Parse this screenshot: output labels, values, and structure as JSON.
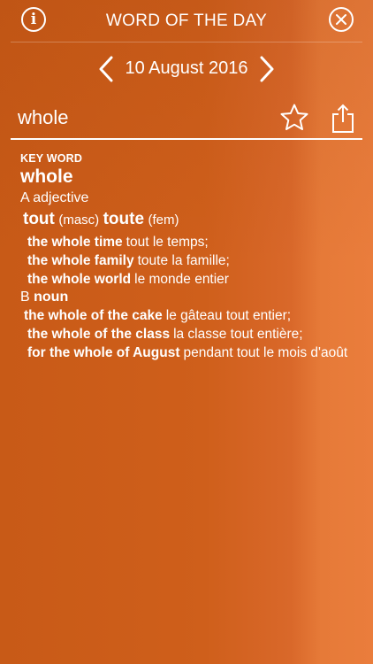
{
  "header": {
    "info_icon": "info-icon",
    "info_glyph": "i",
    "title": "WORD OF THE DAY",
    "close_icon": "close-icon"
  },
  "date_nav": {
    "prev_icon": "chevron-left-icon",
    "date": "10 August 2016",
    "next_icon": "chevron-right-icon"
  },
  "search": {
    "word": "whole",
    "star_icon": "star-icon",
    "share_icon": "share-icon"
  },
  "entry": {
    "label": "KEY WORD",
    "headword": "whole",
    "senses": [
      {
        "letter": "A",
        "pos": "adjective",
        "trans_masc": "tout",
        "masc": "(masc)",
        "trans_fem": "toute",
        "fem": "(fem)",
        "examples": [
          {
            "en": "the whole time",
            "fr": "tout le temps;"
          },
          {
            "en": "the whole family",
            "fr": "toute la famille;"
          },
          {
            "en": "the whole world",
            "fr": "le monde entier"
          }
        ]
      },
      {
        "letter": "B",
        "pos": "noun",
        "examples": [
          {
            "en": "the whole of the cake",
            "fr": "le gâteau tout entier;"
          },
          {
            "en": "the whole of the class",
            "fr": "la classe tout entière;"
          },
          {
            "en": "for the whole of August",
            "fr": "pendant tout le mois d'août"
          }
        ]
      }
    ]
  },
  "colors": {
    "background": "#cc5d1a",
    "foreground": "#ffffff"
  }
}
